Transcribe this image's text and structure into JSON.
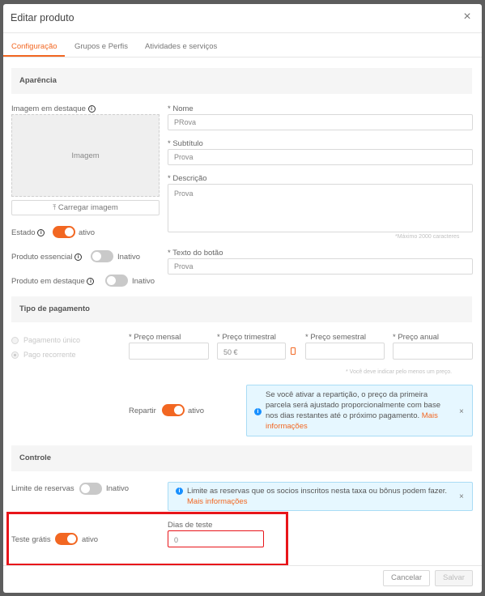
{
  "modal": {
    "title": "Editar produto",
    "close_symbol": "×"
  },
  "tabs": [
    {
      "label": "Configuração",
      "active": true
    },
    {
      "label": "Grupos e Perfis",
      "active": false
    },
    {
      "label": "Atividades e serviços",
      "active": false
    }
  ],
  "appearance": {
    "section_title": "Aparência",
    "image_label": "Imagem em destaque",
    "image_placeholder": "Imagem",
    "upload_label": "Carregar imagem",
    "state_label": "Estado",
    "state_value": "ativo",
    "state_on": true,
    "essential_label": "Produto essencial",
    "essential_value": "Inativo",
    "essential_on": false,
    "featured_label": "Produto em destaque",
    "featured_value": "Inativo",
    "featured_on": false,
    "name_label": "* Nome",
    "name_value": "PRova",
    "subtitle_label": "* Subtítulo",
    "subtitle_value": "Prova",
    "description_label": "* Descrição",
    "description_value": "Prova",
    "description_hint": "*Máximo 2000 caracteres",
    "button_text_label": "* Texto do botão",
    "button_text_value": "Prova"
  },
  "payment": {
    "section_title": "Tipo de pagamento",
    "options": [
      {
        "label": "Pagamento único",
        "checked": false
      },
      {
        "label": "Pago recorrente",
        "checked": true
      }
    ],
    "monthly_label": "* Preço mensal",
    "monthly_value": "",
    "quarterly_label": "* Preço trimestral",
    "quarterly_value": "50 €",
    "semester_label": "* Preço semestral",
    "semester_value": "",
    "annual_label": "* Preço anual",
    "annual_value": "",
    "price_hint": "* Você deve indicar pelo menos um preço.",
    "split_label": "Repartir",
    "split_value": "ativo",
    "split_on": true,
    "alert_text": "Se você ativar a repartição, o preço da primeira parcela será ajustado proporcionalmente com base nos dias restantes até o próximo pagamento.",
    "alert_link": "Mais informações",
    "alert_close": "×"
  },
  "control": {
    "section_title": "Controle",
    "booking_limit_label": "Limite de reservas",
    "booking_limit_value": "Inativo",
    "booking_limit_on": false,
    "alert_text": "Limite as reservas que os socios inscritos nesta taxa ou bônus podem fazer.",
    "alert_link": "Mais informações",
    "alert_close": "×",
    "trial_label": "Teste grátis",
    "trial_value": "ativo",
    "trial_on": true,
    "trial_days_label": "Dias de teste",
    "trial_days_value": "0"
  },
  "footer": {
    "cancel_label": "Cancelar",
    "save_label": "Salvar"
  },
  "colors": {
    "accent": "#f26722",
    "highlight_box": "#e8151a",
    "info_blue": "#1890ff"
  }
}
